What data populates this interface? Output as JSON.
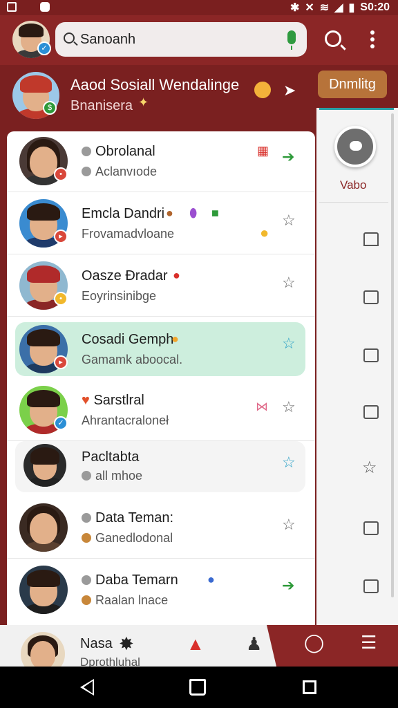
{
  "status_bar": {
    "time": "S0:20",
    "icons": [
      "notification-icon",
      "app-icon",
      "bluetooth-icon",
      "mute-icon",
      "wifi-icon",
      "signal-icon",
      "battery-icon"
    ]
  },
  "header": {
    "search": {
      "value": "Sanoanh",
      "mic_icon": "mic-icon"
    },
    "search_icon": "search-icon",
    "menu_icon": "more-vert-icon",
    "accent": "#8b2626"
  },
  "banner": {
    "title": "Aaod Sosiall Wendalinge",
    "subtitle": "Bnanisera",
    "button_label": "Dnmlitg"
  },
  "chats": [
    {
      "name": "Obrolanal",
      "message": "Aclanvıode",
      "trailing": "arrow",
      "highlight": "none"
    },
    {
      "name": "Emcla Dandri",
      "message": "Frovamadvloane",
      "trailing": "star",
      "highlight": "none"
    },
    {
      "name": "Oasze Đradar",
      "message": "Eoyrinsinibge",
      "trailing": "star",
      "highlight": "none"
    },
    {
      "name": "Cosadi Gemph",
      "message": "Gamamk aboocal.",
      "trailing": "star",
      "highlight": "green"
    },
    {
      "name": "Sarstlral",
      "message": "Ahrantacraloneł",
      "trailing": "star",
      "highlight": "none"
    },
    {
      "name": "Pacltabta",
      "message": "all mhoe",
      "trailing": "star",
      "highlight": "grey"
    },
    {
      "name": "Data Teman:",
      "message": "Ganedlodonal",
      "trailing": "star",
      "highlight": "none"
    },
    {
      "name": "Daba Temarn",
      "message": "Raalan lnace",
      "trailing": "arrow",
      "highlight": "none"
    }
  ],
  "side_rail": {
    "label": "Vabo",
    "accent": "#2aa0a6"
  },
  "bottom_bar": {
    "name": "Nasa",
    "subtitle": "Dprothluhal"
  }
}
